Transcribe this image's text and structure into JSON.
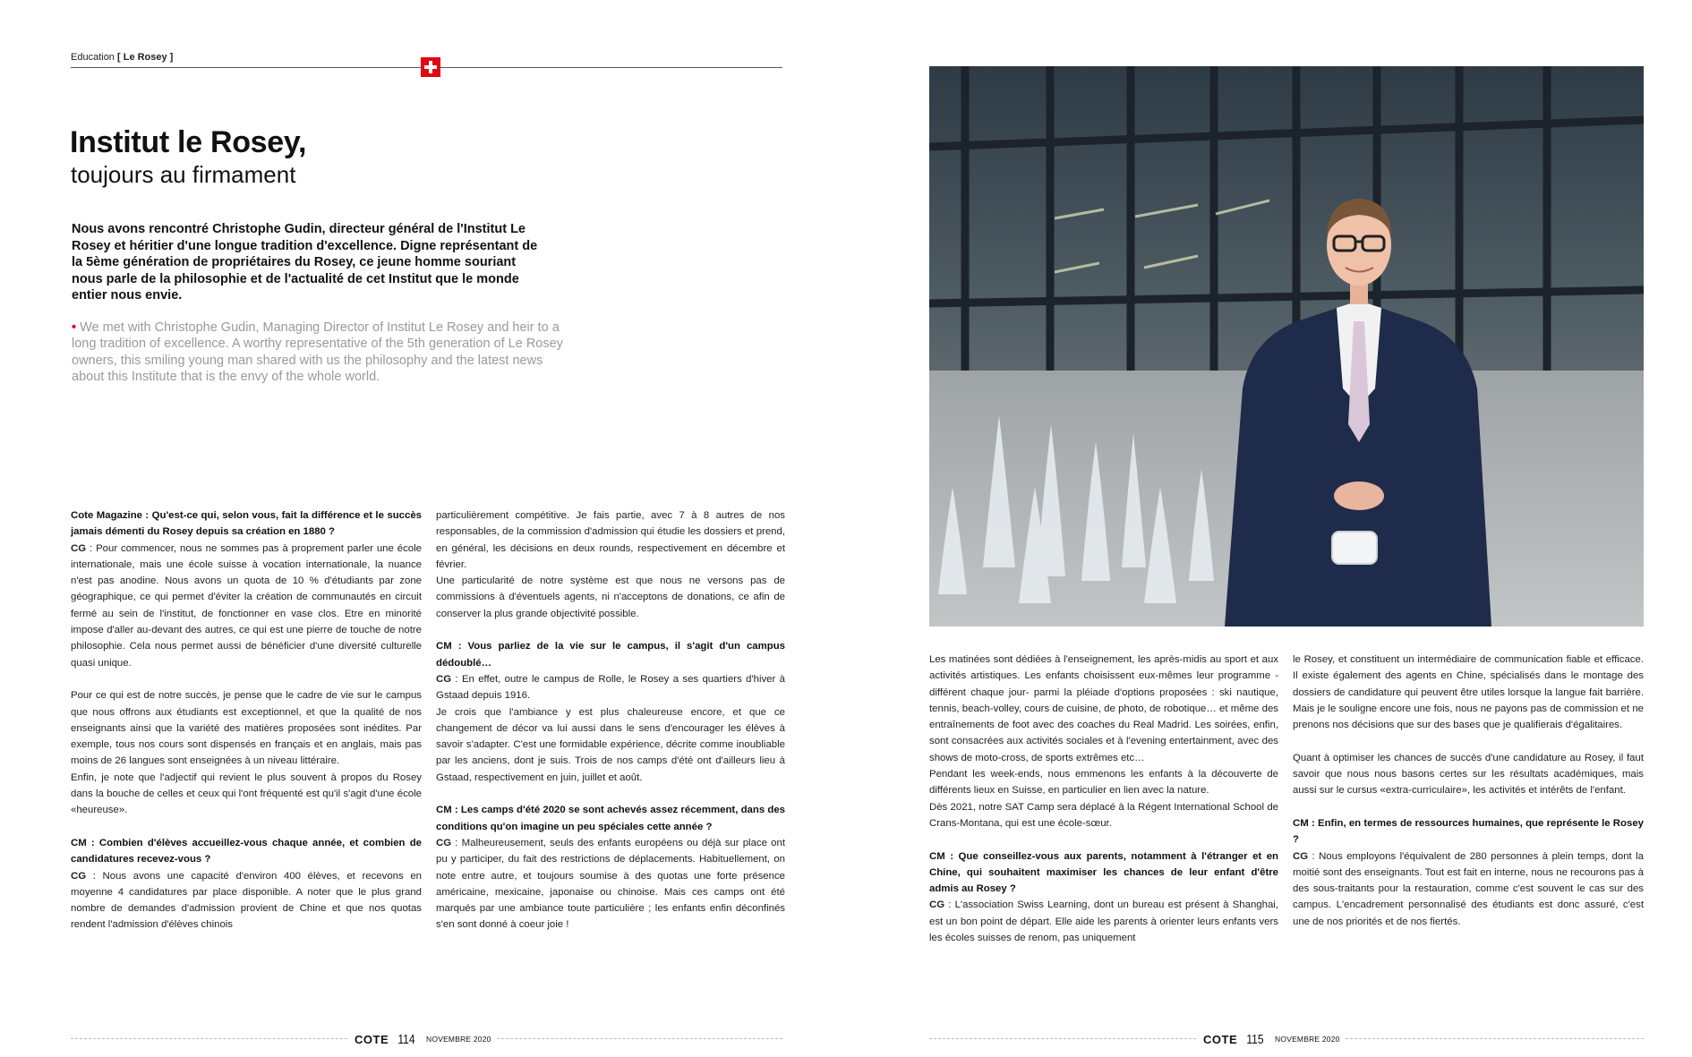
{
  "header": {
    "section": "Education",
    "section_tag": "[ Le Rosey ]"
  },
  "article": {
    "title": "Institut le Rosey,",
    "subtitle": "toujours au firmament",
    "intro_fr": "Nous avons rencontré Christophe Gudin, directeur général de l'Institut Le Rosey et héritier d'une longue tradition d'excellence. Digne représentant de la 5ème génération de propriétaires du Rosey, ce jeune homme souriant nous parle de la philosophie et de l'actualité de cet Institut que le monde entier nous envie.",
    "intro_en_bullet": "•",
    "intro_en": "We met with Christophe Gudin, Managing Director of Institut Le Rosey and heir to a long tradition of excellence. A worthy representative of the 5th generation of Le Rosey owners, this smiling young man shared with us the philosophy and the latest news about this Institute that is the envy of the whole world."
  },
  "body": {
    "col1": {
      "q1": "Cote Magazine : Qu'est-ce qui, selon vous, fait la différence et le succès jamais démenti du Rosey depuis sa création en 1880 ?",
      "a1_sp": "CG",
      "a1": " : Pour commencer, nous ne sommes pas à proprement parler une école internationale, mais une école suisse à vocation internationale, la nuance n'est pas anodine. Nous avons un quota de 10 % d'étudiants par zone géographique, ce qui permet d'éviter la création de communautés en circuit fermé au sein de l'institut, de fonctionner en vase clos. Etre en minorité impose d'aller au-devant des autres, ce qui est une pierre de touche de notre philosophie. Cela nous permet aussi de bénéficier d'une diversité culturelle quasi unique.",
      "p2": "Pour ce qui est de notre succès, je pense que le cadre de vie sur le campus que nous offrons aux étudiants est exceptionnel, et que la qualité de nos enseignants ainsi que la variété des matières proposées sont inédites. Par exemple, tous nos cours sont dispensés en français et en anglais, mais pas moins de 26 langues sont enseignées à un niveau littéraire.",
      "p3": "Enfin, je note que l'adjectif qui revient le plus souvent à propos du Rosey dans la bouche de celles et ceux qui l'ont fréquenté est qu'il s'agit d'une école «heureuse».",
      "q2": "CM : Combien d'élèves accueillez-vous chaque année, et combien de candidatures recevez-vous ?",
      "a2_sp": "CG",
      "a2": " : Nous avons une capacité d'environ 400 élèves, et recevons en moyenne 4 candidatures par place disponible. A noter que le plus grand nombre de demandes d'admission provient de Chine et que nos quotas rendent l'admission d'élèves chinois"
    },
    "col2": {
      "p1": "particulièrement compétitive. Je fais partie, avec 7 à 8 autres de nos responsables, de la commission d'admission qui étudie les dossiers et prend, en général, les décisions en deux rounds, respectivement en décembre et février.",
      "p2": "Une particularité de notre système est que nous ne versons pas de commissions à d'éventuels agents, ni n'acceptons de donations, ce afin de conserver la plus grande objectivité possible.",
      "q1": "CM : Vous parliez de la vie sur le campus, il s'agit d'un campus dédoublé…",
      "a1_sp": "CG",
      "a1": " : En effet, outre le campus de Rolle, le Rosey a ses quartiers d'hiver à Gstaad depuis 1916.",
      "p3": "Je crois que l'ambiance y est plus chaleureuse encore, et que ce changement de décor va lui aussi dans le sens d'encourager les élèves à savoir s'adapter. C'est une formidable expérience, décrite comme inoubliable par les anciens, dont je suis. Trois de nos camps d'été ont d'ailleurs lieu à Gstaad, respectivement en juin, juillet et août.",
      "q2": "CM : Les camps d'été 2020 se sont achevés assez récemment, dans des conditions qu'on imagine un peu spéciales cette année ?",
      "a2_sp": "CG",
      "a2": " : Malheureusement, seuls des enfants européens ou déjà sur place ont pu y participer, du fait des restrictions de déplacements. Habituellement, on note entre autre, et toujours soumise à des quotas une forte présence américaine, mexicaine, japonaise ou chinoise. Mais ces camps ont été marqués par une ambiance toute particulière ; les enfants enfin déconfinés s'en sont donné à coeur joie !"
    },
    "col3": {
      "p1": "Les matinées sont dédiées à l'enseignement, les après-midis au sport et aux activités artistiques. Les enfants choisissent eux-mêmes leur programme -différent chaque jour- parmi la pléiade d'options proposées : ski nautique, tennis, beach-volley, cours de cuisine, de photo, de robotique… et même des entraînements de foot avec des coaches du Real Madrid. Les soirées, enfin, sont consacrées aux activités sociales et à l'evening entertainment, avec des shows de moto-cross, de sports extrêmes etc…",
      "p2": "Pendant les week-ends, nous emmenons les enfants à la découverte de différents lieux en Suisse, en particulier en lien avec la nature.",
      "p3": "Dès 2021, notre SAT Camp sera déplacé à la Régent International School de Crans-Montana, qui est une école-sœur.",
      "q1": "CM : Que conseillez-vous aux parents, notamment à l'étranger et en Chine, qui souhaitent maximiser les chances de leur enfant d'être admis au Rosey ?",
      "a1_sp": "CG",
      "a1": " : L'association Swiss Learning, dont un bureau est présent à Shanghai, est un bon point de départ. Elle aide les parents à orienter leurs enfants vers les écoles suisses de renom, pas uniquement"
    },
    "col4": {
      "p1": "le Rosey, et constituent un intermédiaire de communication fiable et efficace. Il existe également des agents en Chine, spécialisés dans le montage des dossiers de candidature qui peuvent être utiles lorsque la langue fait barrière. Mais je le souligne encore une fois, nous ne payons pas de commission et ne prenons nos décisions que sur des bases que je qualifierais d'égalitaires.",
      "p2": "Quant à optimiser les chances de succès d'une candidature au Rosey, il faut savoir que nous nous basons certes sur les résultats académiques, mais aussi sur le cursus «extra-curriculaire», les activités et intérêts de l'enfant.",
      "q1": "CM : Enfin, en termes de ressources humaines, que représente le Rosey ?",
      "a1_sp": "CG",
      "a1": " : Nous employons l'équivalent de 280 personnes à plein temps, dont la moitié sont des enseignants. Tout est fait en interne, nous ne recourons pas à des sous-traitants pour la restauration, comme c'est souvent le cas sur des campus. L'encadrement personnalisé des étudiants est donc assuré, c'est une de nos priorités et de nos fiertés."
    }
  },
  "footer": {
    "left": {
      "brand": "COTE",
      "page": "114",
      "date": "NOVEMBRE 2020"
    },
    "right": {
      "brand": "COTE",
      "page": "115",
      "date": "NOVEMBRE 2020"
    }
  },
  "colors": {
    "accent_red": "#e30613",
    "english_grey": "#9a9a9a"
  },
  "icons": [
    "swiss-flag-icon"
  ]
}
